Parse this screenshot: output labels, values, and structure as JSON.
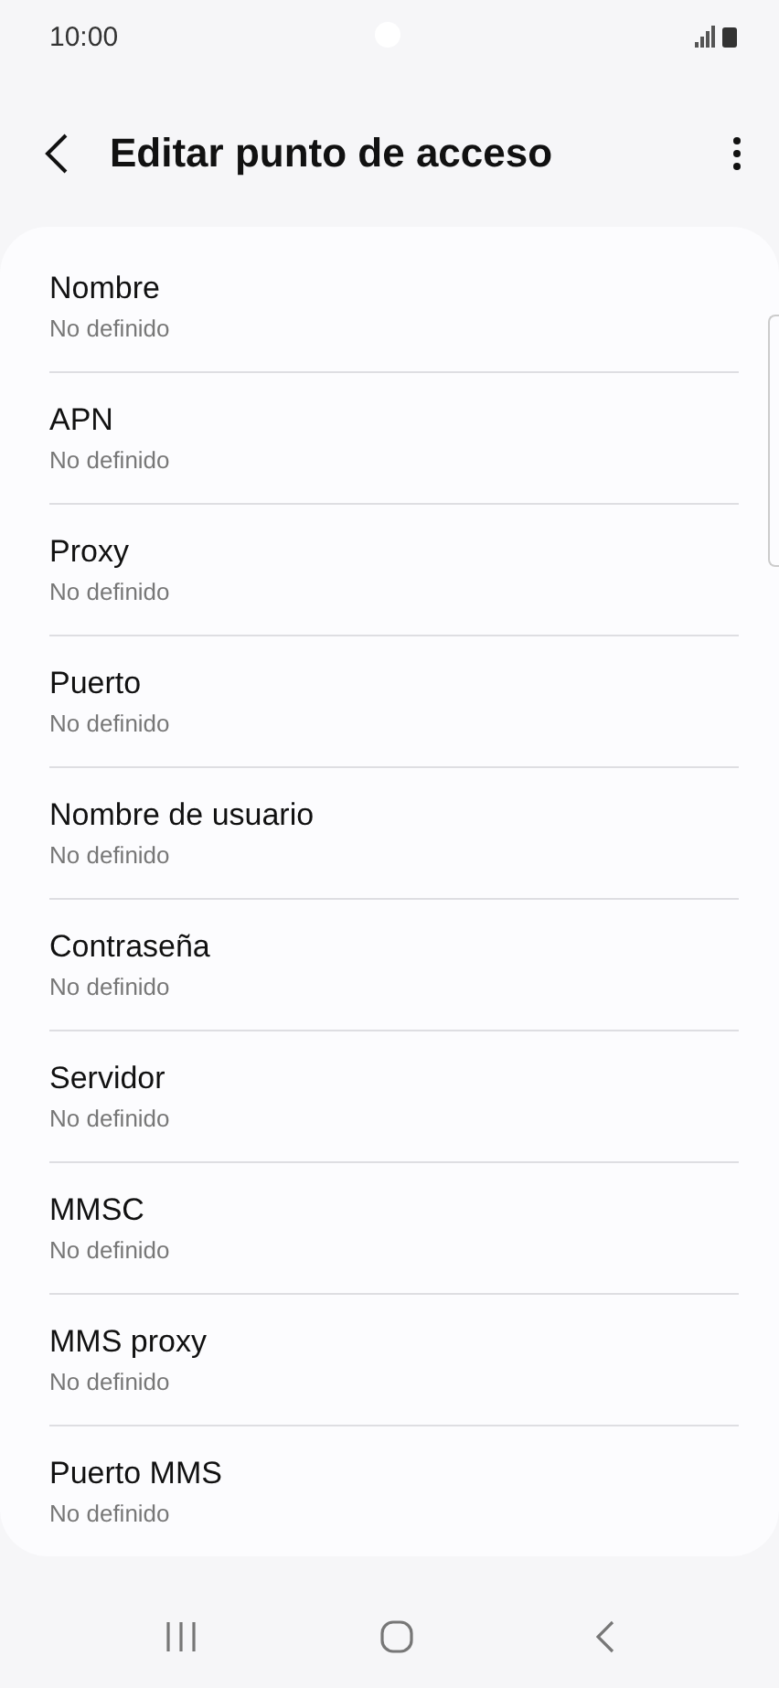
{
  "status_bar": {
    "time": "10:00"
  },
  "header": {
    "title": "Editar punto de acceso"
  },
  "fields": [
    {
      "label": "Nombre",
      "value": "No definido"
    },
    {
      "label": "APN",
      "value": "No definido"
    },
    {
      "label": "Proxy",
      "value": "No definido"
    },
    {
      "label": "Puerto",
      "value": "No definido"
    },
    {
      "label": "Nombre de usuario",
      "value": "No definido"
    },
    {
      "label": "Contraseña",
      "value": "No definido"
    },
    {
      "label": "Servidor",
      "value": "No definido"
    },
    {
      "label": "MMSC",
      "value": "No definido"
    },
    {
      "label": "MMS proxy",
      "value": "No definido"
    },
    {
      "label": "Puerto MMS",
      "value": "No definido"
    }
  ]
}
